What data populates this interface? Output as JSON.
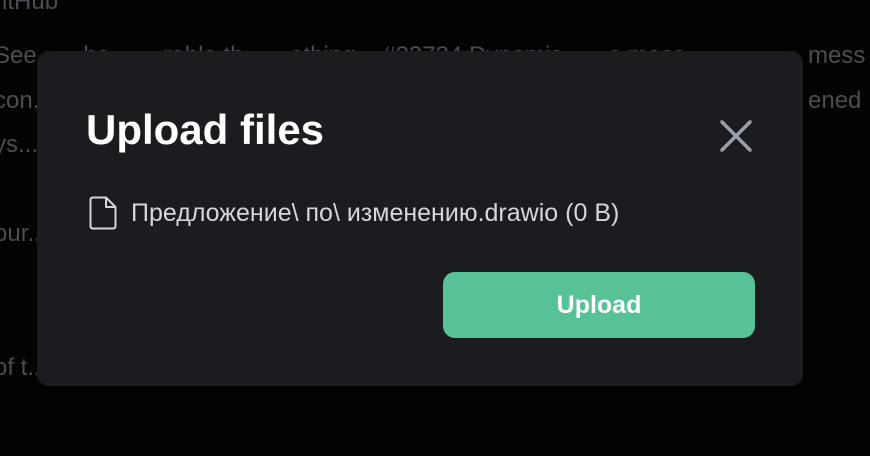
{
  "background": {
    "lines": [
      "ntHub",
      "See... ...he ... ...rable th... ...ething ...#23734 Dynamic... ...s mess",
      "con...",
      "ys...",
      "our...",
      "of t..."
    ],
    "right_fragments": [
      "mess",
      "ened"
    ]
  },
  "modal": {
    "title": "Upload files",
    "close_icon": "close-icon",
    "file": {
      "icon": "file-icon",
      "name": "Предложение\\ по\\ изменению.drawio",
      "size": "(0 B)"
    },
    "upload_label": "Upload"
  },
  "colors": {
    "page_bg": "#030303",
    "modal_bg": "#1a1c20",
    "accent": "#57c296",
    "title": "#ffffff",
    "text": "#d4d6da",
    "close_icon": "#9aa0a9"
  }
}
